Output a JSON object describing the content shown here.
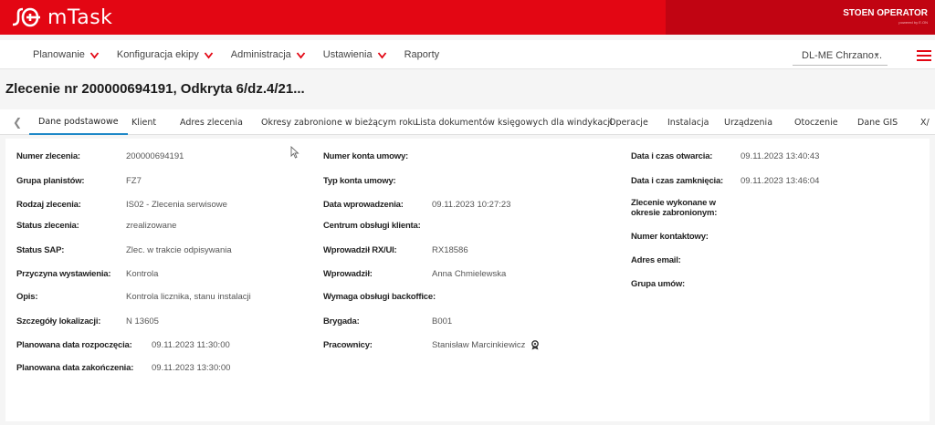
{
  "app": {
    "name": "mTask",
    "operator": "STOEN OPERATOR",
    "operator_sub": "powered by E.ON"
  },
  "menu": {
    "items": [
      {
        "label": "Planowanie",
        "has_dropdown": true
      },
      {
        "label": "Konfiguracja ekipy",
        "has_dropdown": true
      },
      {
        "label": "Administracja",
        "has_dropdown": true
      },
      {
        "label": "Ustawienia",
        "has_dropdown": true
      },
      {
        "label": "Raporty",
        "has_dropdown": false
      }
    ],
    "selector_value": "DL-ME Chrzano...",
    "accent_color": "#e30613"
  },
  "page": {
    "title": "Zlecenie nr 200000694191, Odkryta 6/dz.4/21..."
  },
  "tabs": [
    {
      "label": "Dane podstawowe",
      "active": true
    },
    {
      "label": "Klient",
      "active": false
    },
    {
      "label": "Adres zlecenia",
      "active": false
    },
    {
      "label": "Okresy zabronione w bieżącym roku",
      "active": false
    },
    {
      "label": "Lista dokumentów księgowych dla windykacji",
      "active": false
    },
    {
      "label": "Operacje",
      "active": false
    },
    {
      "label": "Instalacja",
      "active": false
    },
    {
      "label": "Urządzenia",
      "active": false
    },
    {
      "label": "Otoczenie",
      "active": false
    },
    {
      "label": "Dane GIS",
      "active": false
    },
    {
      "label": "X/",
      "active": false
    }
  ],
  "details": {
    "col1": [
      {
        "label": "Numer zlecenia:",
        "value": "200000694191"
      },
      {
        "label": "Grupa planistów:",
        "value": "FZ7"
      },
      {
        "label": "Rodzaj zlecenia:",
        "value": "IS02 - Zlecenia serwisowe"
      },
      {
        "label": "Status zlecenia:",
        "value": "zrealizowane"
      },
      {
        "label": "Status SAP:",
        "value": "Zlec. w trakcie odpisywania"
      },
      {
        "label": "Przyczyna wystawienia:",
        "value": "Kontrola"
      },
      {
        "label": "Opis:",
        "value": "Kontrola licznika, stanu instalacji"
      },
      {
        "label": "Szczegóły lokalizacji:",
        "value": "N 13605"
      },
      {
        "label": "Planowana data rozpoczęcia:",
        "value": "09.11.2023 11:30:00"
      },
      {
        "label": "Planowana data zakończenia:",
        "value": "09.11.2023 13:30:00"
      }
    ],
    "col2": [
      {
        "label": "Numer konta umowy:",
        "value": ""
      },
      {
        "label": "Typ konta umowy:",
        "value": ""
      },
      {
        "label": "Data wprowadzenia:",
        "value": "09.11.2023 10:27:23"
      },
      {
        "label": "Centrum obsługi klienta:",
        "value": ""
      },
      {
        "label": "Wprowadził RX/UI:",
        "value": "RX18586"
      },
      {
        "label": "Wprowadził:",
        "value": "Anna Chmielewska"
      },
      {
        "label": "Wymaga obsługi backoffice:",
        "value": ""
      },
      {
        "label": "Brygada:",
        "value": "B001"
      },
      {
        "label": "Pracownicy:",
        "value": "Stanisław Marcinkiewicz"
      }
    ],
    "col3": [
      {
        "label": "Data i czas otwarcia:",
        "value": "09.11.2023 13:40:43"
      },
      {
        "label": "Data i czas zamknięcia:",
        "value": "09.11.2023 13:46:04"
      },
      {
        "label": "Zlecenie wykonane w okresie zabronionym:",
        "value": ""
      },
      {
        "label": "Numer kontaktowy:",
        "value": ""
      },
      {
        "label": "Adres email:",
        "value": ""
      },
      {
        "label": "Grupa umów:",
        "value": ""
      }
    ]
  }
}
